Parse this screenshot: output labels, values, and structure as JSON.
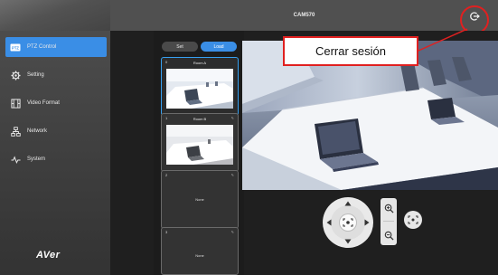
{
  "window": {
    "title": "CAM570"
  },
  "header": {
    "logout_icon": "logout-icon"
  },
  "sidebar": {
    "items": [
      {
        "label": "PTZ Control",
        "icon": "ptz-icon",
        "active": true
      },
      {
        "label": "Setting",
        "icon": "gear-icon",
        "active": false
      },
      {
        "label": "Video Format",
        "icon": "film-icon",
        "active": false
      },
      {
        "label": "Network",
        "icon": "network-icon",
        "active": false
      },
      {
        "label": "System",
        "icon": "pulse-icon",
        "active": false
      }
    ],
    "logo": "AVer"
  },
  "presets": {
    "set_label": "Set",
    "load_label": "Load",
    "items": [
      {
        "num": "0",
        "name": "Room A",
        "active": true
      },
      {
        "num": "1",
        "name": "Room B",
        "active": false
      },
      {
        "num": "2",
        "name": "None",
        "active": false
      },
      {
        "num": "3",
        "name": "None",
        "active": false
      }
    ]
  },
  "annotation": {
    "callout_text": "Cerrar sesión"
  },
  "colors": {
    "accent": "#3a8ee6",
    "callout_border": "#e02020"
  }
}
